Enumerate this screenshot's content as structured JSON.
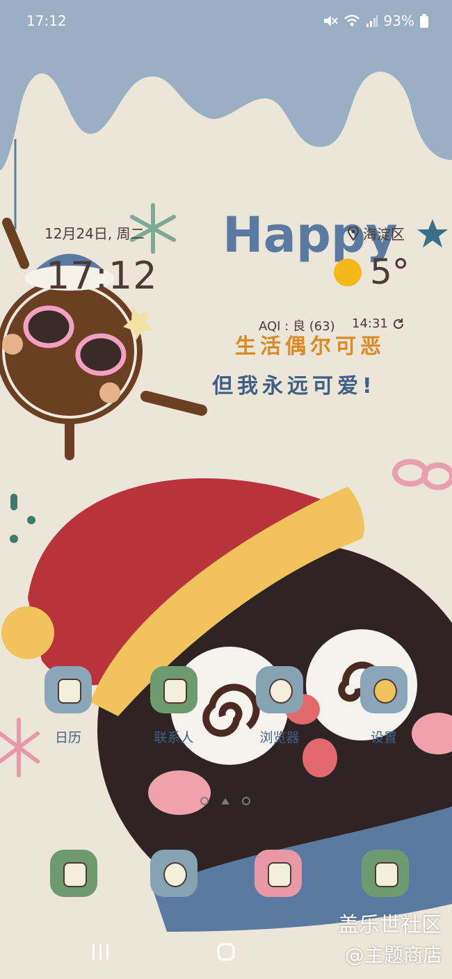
{
  "status_bar": {
    "time": "17:12",
    "battery": "93%",
    "icons": [
      "mute-icon",
      "wifi-icon",
      "signal-icon",
      "battery-icon"
    ]
  },
  "clock_widget": {
    "date": "12月24日, 周二",
    "time": "17:12"
  },
  "weather_widget": {
    "location": "海淀区",
    "temperature": "5°",
    "condition_icon": "sun-icon",
    "aqi": "AQI : 良 (63)",
    "updated": "14:31"
  },
  "wallpaper": {
    "headline": "Happy",
    "line1": "生活偶尔可恶",
    "line2": "但我永远可爱!"
  },
  "home_apps": [
    {
      "label": "日历",
      "icon": "calendar-icon",
      "color": "#8aa6b8"
    },
    {
      "label": "联系人",
      "icon": "contacts-icon",
      "color": "#6d9a6f"
    },
    {
      "label": "浏览器",
      "icon": "browser-icon",
      "color": "#86a3b4"
    },
    {
      "label": "设置",
      "icon": "settings-icon",
      "color": "#8aa6b8"
    }
  ],
  "dock_apps": [
    {
      "icon": "phone-icon",
      "color": "#6d9a6f"
    },
    {
      "icon": "messages-icon",
      "color": "#86a3b4"
    },
    {
      "icon": "camera-icon",
      "color": "#e79aa5"
    },
    {
      "icon": "gallery-icon",
      "color": "#6d9a6f"
    }
  ],
  "watermark": {
    "line1": "盖乐世社区",
    "line2": "@主题商店"
  },
  "colors": {
    "text_dark": "#4a3b35",
    "label_blue": "#3f5f86",
    "sun": "#f5b91a"
  }
}
